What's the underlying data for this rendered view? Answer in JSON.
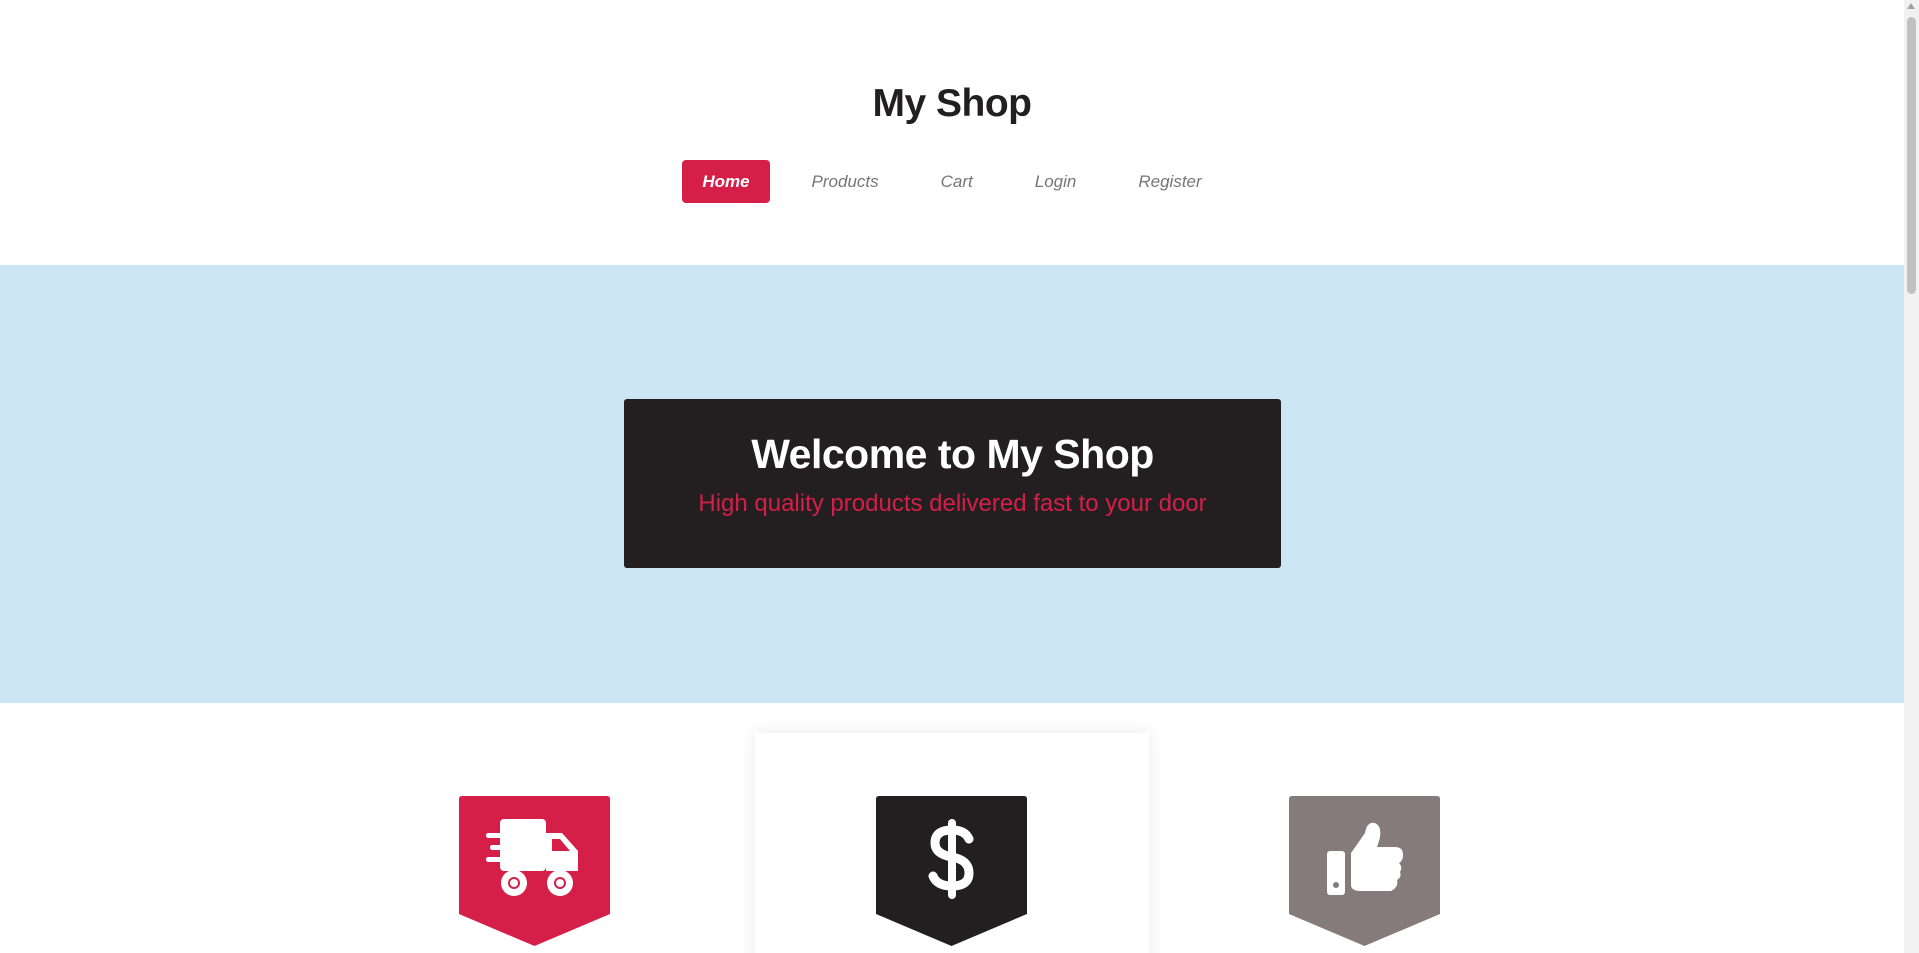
{
  "header": {
    "title": "My Shop"
  },
  "nav": {
    "items": [
      {
        "label": "Home",
        "active": true
      },
      {
        "label": "Products",
        "active": false
      },
      {
        "label": "Cart",
        "active": false
      },
      {
        "label": "Login",
        "active": false
      },
      {
        "label": "Register",
        "active": false
      }
    ]
  },
  "hero": {
    "title": "Welcome to My Shop",
    "subtitle": "High quality products delivered fast to your door"
  },
  "features": [
    {
      "icon": "delivery-truck-icon",
      "color": "#d61f48"
    },
    {
      "icon": "dollar-sign-icon",
      "color": "#231f20"
    },
    {
      "icon": "thumbs-up-icon",
      "color": "#857a7c"
    }
  ],
  "colors": {
    "accent": "#d61f48",
    "dark": "#231f20",
    "hero_bg": "#cce7f3",
    "muted": "#857a7c"
  }
}
